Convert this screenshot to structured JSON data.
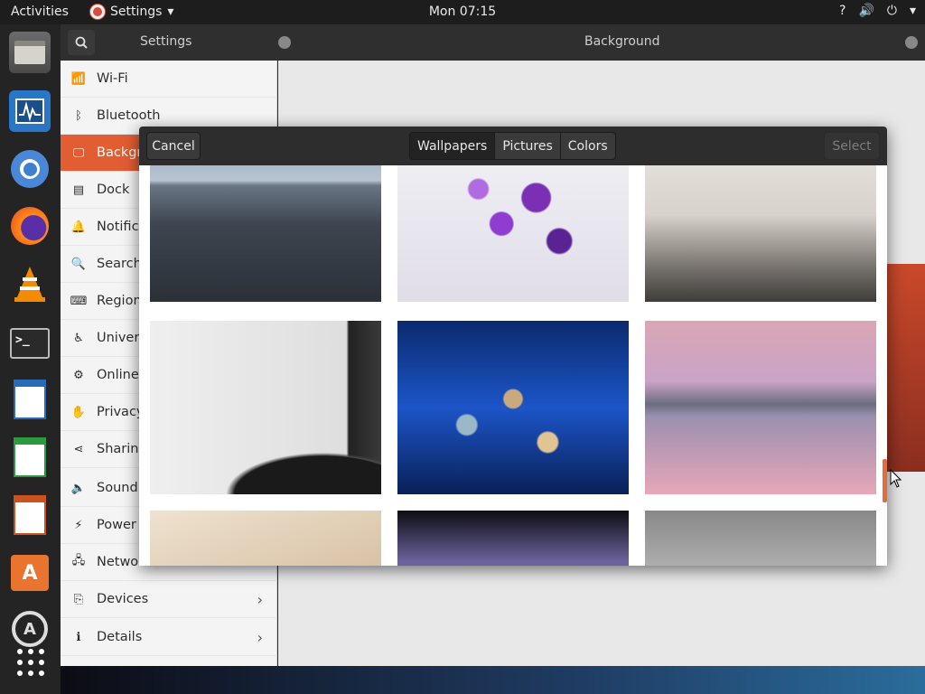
{
  "topbar": {
    "activities": "Activities",
    "app_menu": "Settings",
    "app_menu_arrow": "▾",
    "clock": "Mon 07:15",
    "tray_network": "?",
    "tray_volume": "🔊",
    "tray_power": "⏻",
    "tray_arrow": "▾"
  },
  "dock": {
    "items": [
      "files-icon",
      "system-monitor-icon",
      "chromium-icon",
      "firefox-icon",
      "vlc-icon",
      "terminal-icon",
      "libreoffice-writer-icon",
      "libreoffice-calc-icon",
      "libreoffice-impress-icon",
      "software-center-icon",
      "software-updater-icon"
    ]
  },
  "window": {
    "left_title": "Settings",
    "main_title": "Background"
  },
  "sidebar": {
    "items": [
      {
        "label": "Wi-Fi",
        "icon": "wifi-icon",
        "glyph": "📶"
      },
      {
        "label": "Bluetooth",
        "icon": "bluetooth-icon",
        "glyph": "ᛒ"
      },
      {
        "label": "Backgro",
        "icon": "background-icon",
        "glyph": "🖵"
      },
      {
        "label": "Dock",
        "icon": "dock-icon",
        "glyph": "▤"
      },
      {
        "label": "Notific",
        "icon": "notifications-icon",
        "glyph": "🔔"
      },
      {
        "label": "Search",
        "icon": "search-icon",
        "glyph": "🔍"
      },
      {
        "label": "Region",
        "icon": "region-icon",
        "glyph": "⌨"
      },
      {
        "label": "Univers",
        "icon": "universal-access-icon",
        "glyph": "♿"
      },
      {
        "label": "Online",
        "icon": "online-accounts-icon",
        "glyph": "⚙"
      },
      {
        "label": "Privacy",
        "icon": "privacy-icon",
        "glyph": "✋"
      },
      {
        "label": "Sharing",
        "icon": "sharing-icon",
        "glyph": "⋖"
      },
      {
        "label": "Sound",
        "icon": "sound-icon",
        "glyph": "🔈"
      },
      {
        "label": "Power",
        "icon": "power-icon",
        "glyph": "⚡"
      },
      {
        "label": "Network",
        "icon": "network-icon",
        "glyph": "🖧"
      },
      {
        "label": "Devices",
        "icon": "devices-icon",
        "glyph": "⎘"
      },
      {
        "label": "Details",
        "icon": "details-icon",
        "glyph": "ℹ"
      }
    ],
    "chevron": "›"
  },
  "dialog": {
    "cancel": "Cancel",
    "select": "Select",
    "tabs": [
      "Wallpapers",
      "Pictures",
      "Colors"
    ],
    "selected_tab": "Wallpapers"
  },
  "colors": {
    "accent": "#e35d33",
    "topbar": "#1d1d1d",
    "header": "#2d2d2d"
  }
}
